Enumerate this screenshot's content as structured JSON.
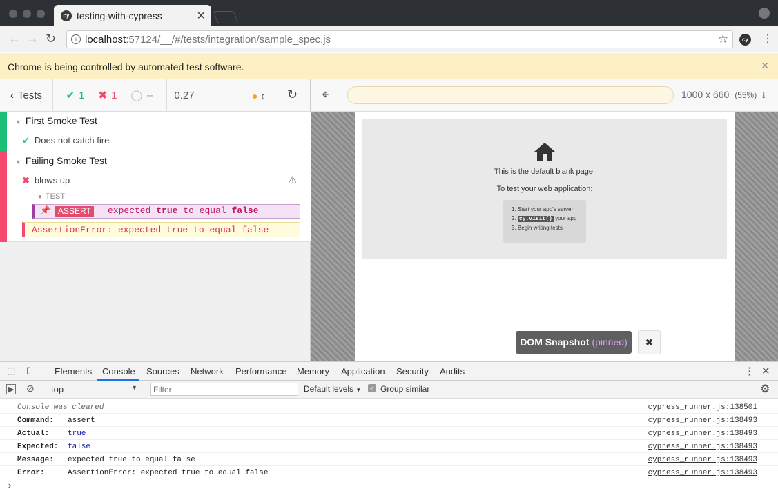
{
  "window": {
    "tab_title": "testing-with-cypress",
    "tab_favicon": "cy"
  },
  "address": {
    "host": "localhost",
    "rest": ":57124/__/#/tests/integration/sample_spec.js"
  },
  "infobar": {
    "message": "Chrome is being controlled by automated test software."
  },
  "reporter": {
    "tests_label": "Tests",
    "passed": "1",
    "failed": "1",
    "pending": "--",
    "duration": "0.27",
    "suites": [
      {
        "title": "First Smoke Test",
        "tests": [
          {
            "title": "Does not catch fire",
            "state": "passed"
          }
        ]
      },
      {
        "title": "Failing Smoke Test",
        "tests": [
          {
            "title": "blows up",
            "state": "failed"
          }
        ]
      }
    ],
    "hook_label": "TEST",
    "command": {
      "name": "ASSERT",
      "message_parts": [
        "expected",
        "true",
        "to equal",
        "false"
      ]
    },
    "error": "AssertionError: expected true to equal false"
  },
  "preview": {
    "dimensions": "1000 x 660",
    "zoom": "(55%)",
    "blank_page_line1": "This is the default blank page.",
    "blank_page_line2": "To test your web application:",
    "steps": [
      "Start your app's server",
      "your app",
      "Begin writing tests"
    ],
    "step2_code": "cy.visit()",
    "snapshot_label": "DOM Snapshot",
    "snapshot_pinned": "(pinned)"
  },
  "devtools": {
    "tabs": [
      "Elements",
      "Console",
      "Sources",
      "Network",
      "Performance",
      "Memory",
      "Application",
      "Security",
      "Audits"
    ],
    "active_tab": "Console",
    "context": "top",
    "filter_placeholder": "Filter",
    "levels": "Default levels",
    "group_similar": "Group similar",
    "cleared": "Console was cleared",
    "cleared_src": "cypress_runner.js:138501",
    "rows": [
      {
        "key": "Command:",
        "value": "assert",
        "src": "cypress_runner.js:138493",
        "value_color": "#222"
      },
      {
        "key": "Actual:",
        "value": "true",
        "src": "cypress_runner.js:138493",
        "value_color": "#1a1aa6"
      },
      {
        "key": "Expected:",
        "value": "false",
        "src": "cypress_runner.js:138493",
        "value_color": "#1a1aa6"
      },
      {
        "key": "Message:",
        "value": "expected true to equal false",
        "src": "cypress_runner.js:138493",
        "value_color": "#222"
      },
      {
        "key": "Error:",
        "value": "AssertionError: expected true to equal false",
        "src": "cypress_runner.js:138493",
        "value_color": "#222"
      }
    ]
  },
  "colors": {
    "pass": "#1dbe78",
    "fail": "#f54a6d",
    "command_pinned": "#9b3fa3"
  }
}
